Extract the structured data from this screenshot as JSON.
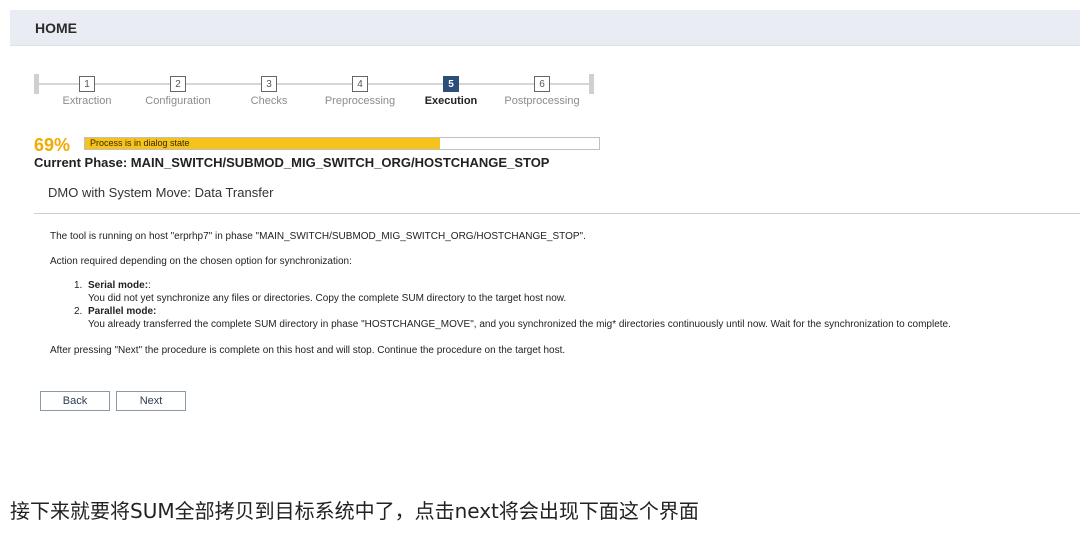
{
  "header": {
    "title": "HOME"
  },
  "roadmap": {
    "steps": [
      {
        "number": "1",
        "label": "Extraction"
      },
      {
        "number": "2",
        "label": "Configuration"
      },
      {
        "number": "3",
        "label": "Checks"
      },
      {
        "number": "4",
        "label": "Preprocessing"
      },
      {
        "number": "5",
        "label": "Execution"
      },
      {
        "number": "6",
        "label": "Postprocessing"
      }
    ],
    "active_step": 5
  },
  "progress": {
    "percent_text": "69%",
    "value": 0.69,
    "status_text": "Process is in dialog state",
    "color": "#f6c21c"
  },
  "phase": {
    "current_phase": "Current Phase: MAIN_SWITCH/SUBMOD_MIG_SWITCH_ORG/HOSTCHANGE_STOP",
    "subtitle": "DMO with System Move: Data Transfer"
  },
  "message": {
    "line1": "The tool is running on host \"erprhp7\" in phase \"MAIN_SWITCH/SUBMOD_MIG_SWITCH_ORG/HOSTCHANGE_STOP\".",
    "line2": "Action required depending on the chosen option for synchronization:",
    "items": [
      {
        "num": "1.",
        "title": "Serial mode:",
        "title_suffix": ":",
        "desc": "You did not yet synchronize any files or directories. Copy the complete SUM directory to the target host now."
      },
      {
        "num": "2.",
        "title": "Parallel mode:",
        "title_suffix": "",
        "desc": "You already transferred the complete SUM directory in phase \"HOSTCHANGE_MOVE\", and you synchronized the mig* directories continuously until now. Wait for the synchronization to complete."
      }
    ],
    "line3": "After pressing \"Next\" the procedure is complete on this host and will stop. Continue the procedure on the target host."
  },
  "buttons": {
    "back": "Back",
    "next": "Next"
  },
  "caption": "接下来就要将SUM全部拷贝到目标系统中了，点击next将会出现下面这个界面"
}
